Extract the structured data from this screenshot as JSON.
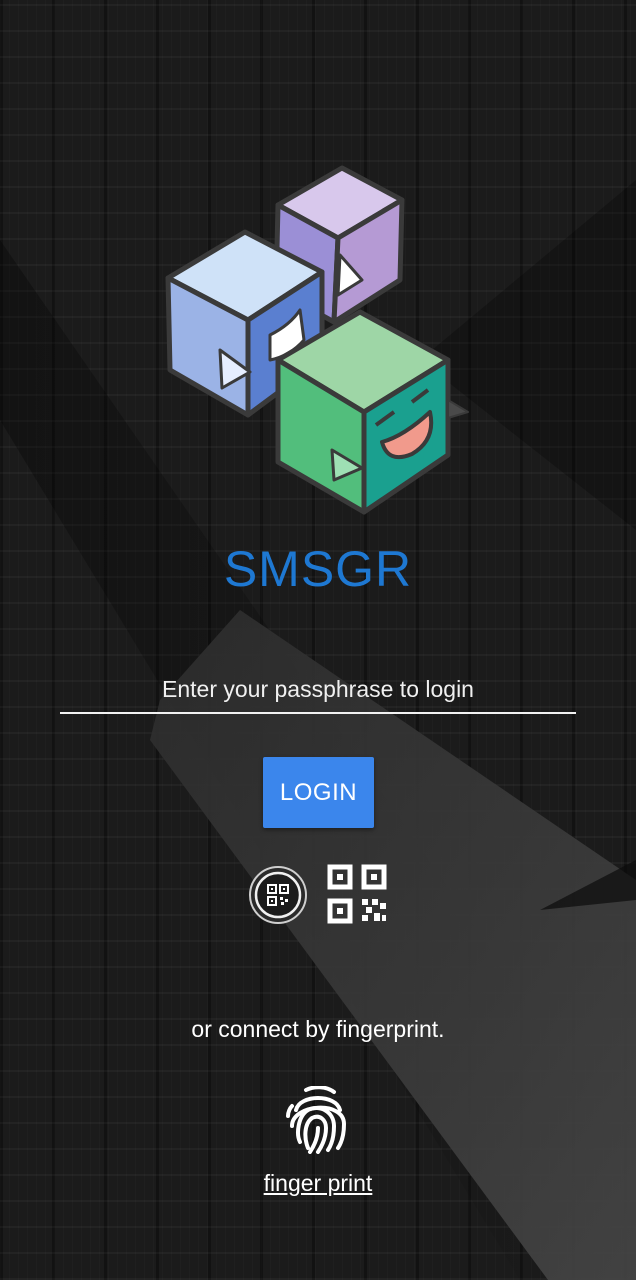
{
  "app": {
    "title": "SMSGR"
  },
  "login": {
    "passphrase_placeholder": "Enter your passphrase to login",
    "passphrase_value": "",
    "button_label": "LOGIN"
  },
  "qr": {
    "scan_icon": "qr-code-circle-icon",
    "code_icon": "qr-code-icon"
  },
  "fingerprint": {
    "prompt": "or connect by fingerprint.",
    "icon": "fingerprint-icon",
    "link_label": "finger print"
  },
  "colors": {
    "title": "#1e78d2",
    "button": "#3b86ec",
    "background": "#1b1b1b",
    "text": "#ffffff"
  }
}
